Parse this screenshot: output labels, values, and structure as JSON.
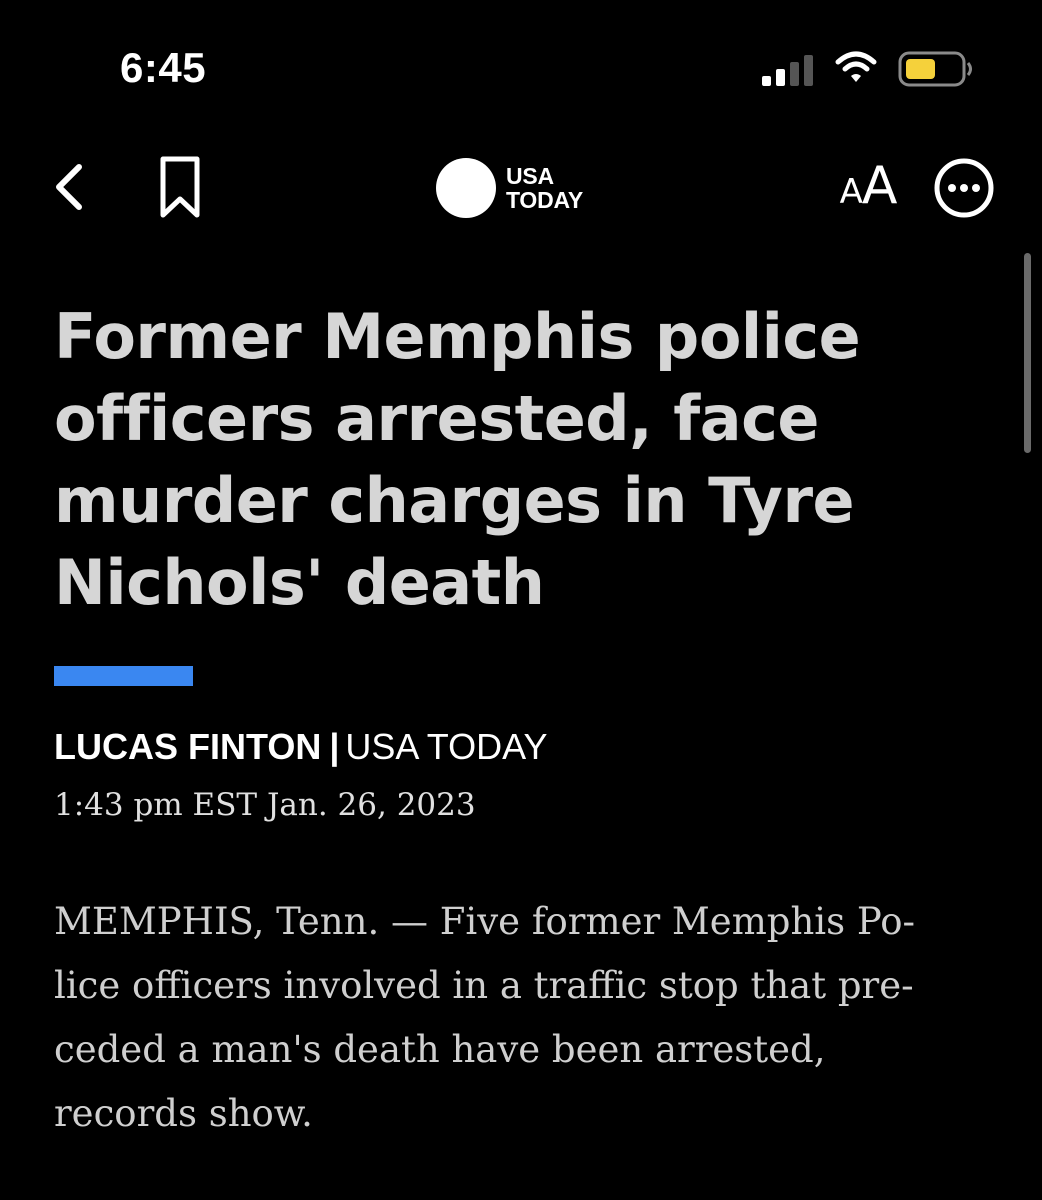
{
  "status_bar": {
    "time": "6:45",
    "signal_icon": "cellular-signal-icon",
    "wifi_icon": "wifi-icon",
    "battery_icon": "battery-low-power-icon",
    "battery_color": "#f5d13b"
  },
  "nav": {
    "back_icon": "chevron-left-icon",
    "bookmark_icon": "bookmark-icon",
    "brand_line1": "USA",
    "brand_line2": "TODAY",
    "font_size_small": "A",
    "font_size_large": "A",
    "more_icon": "ellipsis-circle-icon"
  },
  "article": {
    "headline": "Former Memphis police officers arrested, face murder charges in Tyre Nichols' death",
    "accent_color": "#3a87f1",
    "author": "LUCAS FINTON",
    "separator": "|",
    "outlet": "USA TODAY",
    "timestamp": "1:43 pm EST Jan. 26, 2023",
    "body_lines": [
      "MEMPHIS, Tenn. — Five former Memphis Po-",
      "lice officers involved in a traffic stop that pre-",
      "ceded a man's death have been arrested,",
      "records show."
    ]
  }
}
